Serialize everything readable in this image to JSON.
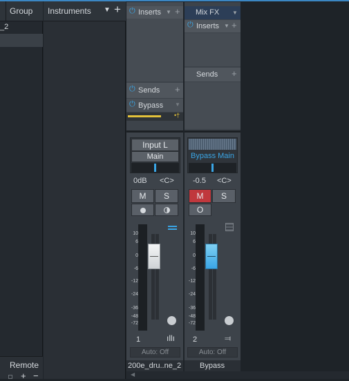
{
  "left_panel": {
    "header_label": "Group",
    "item_label": "_2",
    "remote_label": "Remote"
  },
  "instruments_panel": {
    "header_label": "Instruments"
  },
  "channel1": {
    "inserts_label": "Inserts",
    "sends_label": "Sends",
    "bypass_label": "Bypass",
    "input_label": "Input L",
    "output_label": "Main",
    "volume_label": "0dB",
    "pan_label": "<C>",
    "mute_label": "M",
    "solo_label": "S",
    "number_label": "1",
    "automation_label": "Auto: Off",
    "name_label": "200e_dru..ne_2"
  },
  "channel2": {
    "header_label": "Mix FX",
    "inserts_label": "Inserts",
    "sends_label": "Sends",
    "output_label": "Bypass Main",
    "volume_label": "-0.5",
    "pan_label": "<C>",
    "mute_label": "M",
    "solo_label": "S",
    "o_label": "O",
    "number_label": "2",
    "automation_label": "Auto: Off",
    "name_label": "Bypass"
  },
  "meter_scale": [
    "10",
    "6",
    "0",
    "-6",
    "-12",
    "-24",
    "-36",
    "-48",
    "-72"
  ],
  "colors": {
    "accent_blue": "#3aa6e6",
    "mute_red": "#c0383d",
    "meter_yellow": "#e4c23a"
  }
}
